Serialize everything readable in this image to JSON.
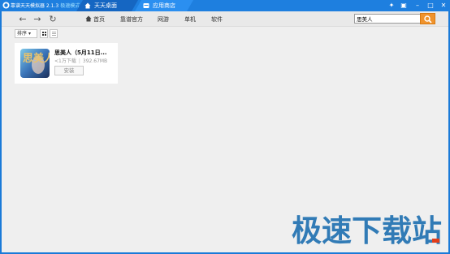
{
  "titlebar": {
    "app_title": "靠谱天天模拟器 2.1.3",
    "app_mode": "极速模式",
    "tabs": [
      {
        "label": "天天桌面",
        "icon": "home-icon"
      },
      {
        "label": "应用商店",
        "icon": "store-icon"
      }
    ],
    "window_buttons": [
      "pin-icon",
      "settings-icon",
      "minimize-icon",
      "maximize-icon",
      "close-icon"
    ]
  },
  "toolbar": {
    "nav_items": [
      {
        "label": "首页",
        "icon": "home-icon"
      },
      {
        "label": "靠谱官方"
      },
      {
        "label": "网游"
      },
      {
        "label": "单机"
      },
      {
        "label": "软件"
      }
    ],
    "search": {
      "value": "思美人",
      "icon": "search-icon"
    }
  },
  "filter": {
    "sort_label": "排序"
  },
  "apps": [
    {
      "title": "思美人（5月11日...",
      "downloads": "<1万下载",
      "size": "392.67MB",
      "install_label": "安装",
      "icon_text": "思美人"
    }
  ],
  "watermark": "极速下载站",
  "colors": {
    "titlebar": "#1e7fdf",
    "accent_orange": "#f0932c",
    "background": "#efefef",
    "watermark": "#1d6fb0"
  }
}
